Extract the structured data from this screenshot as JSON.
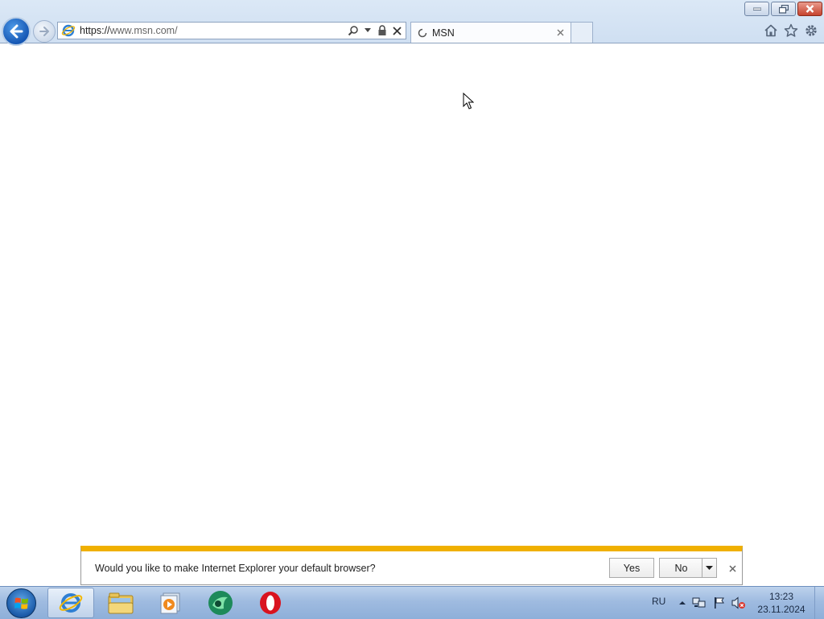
{
  "browser": {
    "address": {
      "url_prefix": "https://",
      "url_rest": "www.msn.com/"
    },
    "tab": {
      "title": "MSN",
      "loading": true
    },
    "toolbar_icons": [
      "home-icon",
      "favorites-star-icon",
      "tools-gear-icon"
    ],
    "window_buttons": [
      "minimize",
      "restore",
      "close"
    ]
  },
  "notification": {
    "message": "Would you like to make Internet Explorer your default browser?",
    "yes_label": "Yes",
    "no_label": "No",
    "accent_color": "#f0b000"
  },
  "taskbar": {
    "pinned": [
      "internet-explorer",
      "windows-explorer",
      "media-player",
      "app",
      "opera"
    ],
    "active": "internet-explorer",
    "language": "RU",
    "time": "13:23",
    "date": "23.11.2024"
  }
}
